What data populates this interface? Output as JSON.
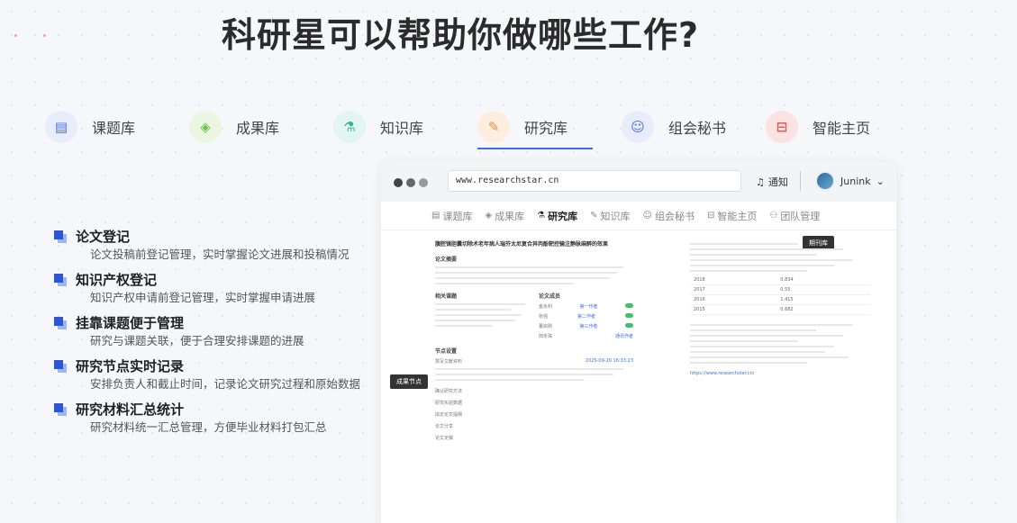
{
  "page": {
    "headline": "科研星可以帮助你做哪些工作?"
  },
  "tabs": [
    {
      "label": "课题库",
      "icon": "topic-library-icon",
      "color": "#4a6fe3",
      "bg": "#e8ecfb"
    },
    {
      "label": "成果库",
      "icon": "achievement-library-icon",
      "color": "#6cc24a",
      "bg": "#eaf6e2"
    },
    {
      "label": "知识库",
      "icon": "knowledge-library-icon",
      "color": "#32b39b",
      "bg": "#e3f5f0"
    },
    {
      "label": "研究库",
      "icon": "research-library-icon",
      "color": "#f08c3a",
      "bg": "#fdeee0"
    },
    {
      "label": "组会秘书",
      "icon": "meeting-secretary-icon",
      "color": "#4a6fe3",
      "bg": "#e8ecfb"
    },
    {
      "label": "智能主页",
      "icon": "smart-homepage-icon",
      "color": "#e05a5a",
      "bg": "#fbe3e3"
    }
  ],
  "features": [
    {
      "title": "论文登记",
      "desc": "论文投稿前登记管理，实时掌握论文进展和投稿情况"
    },
    {
      "title": "知识产权登记",
      "desc": "知识产权申请前登记管理，实时掌握申请进展"
    },
    {
      "title": "挂靠课题便于管理",
      "desc": "研究与课题关联，便于合理安排课题的进展"
    },
    {
      "title": "研究节点实时记录",
      "desc": "安排负责人和截止时间，记录论文研究过程和原始数据"
    },
    {
      "title": "研究材料汇总统计",
      "desc": "研究材料统一汇总管理，方便毕业材料打包汇总"
    }
  ],
  "browser": {
    "url": "www.researchstar.cn",
    "notify_label": "通知",
    "user_name": "Junink",
    "tabs": [
      {
        "label": "课题库",
        "icon": "topic-icon"
      },
      {
        "label": "成果库",
        "icon": "cube-icon"
      },
      {
        "label": "研究库",
        "icon": "flask-icon",
        "active": true
      },
      {
        "label": "知识库",
        "icon": "book-icon"
      },
      {
        "label": "组会秘书",
        "icon": "person-icon"
      },
      {
        "label": "智能主页",
        "icon": "home-icon"
      },
      {
        "label": "团队管理",
        "icon": "team-icon"
      }
    ],
    "doc": {
      "title": "腹腔镜胆囊切除术老年病人瑞芬太尼复合异丙酚靶控输注静脉麻醉的效果",
      "journal_badge": "期刊库",
      "node_badge": "成果节点",
      "sections": [
        "论文摘要",
        "相关课题",
        "论文成员",
        "节点设置"
      ],
      "member_tags": [
        "第一作者",
        "第二作者",
        "第三作者",
        "通讯作者"
      ],
      "members": [
        "金永利",
        "张强",
        "董启刚",
        "田冬珠"
      ],
      "node_items": [
        "撰写文献资料",
        "确认研究方法",
        "研究实验数据",
        "拟定论文提纲",
        "论文分享",
        "论文定稿"
      ],
      "node_date": "2025-09-20 16:33:23",
      "table_years": [
        "2018",
        "2017",
        "2016",
        "2015"
      ],
      "table_values": [
        "0.834",
        "0.55",
        "1.415",
        "0.682"
      ],
      "link": "https://www.researchstar.cn/"
    }
  }
}
